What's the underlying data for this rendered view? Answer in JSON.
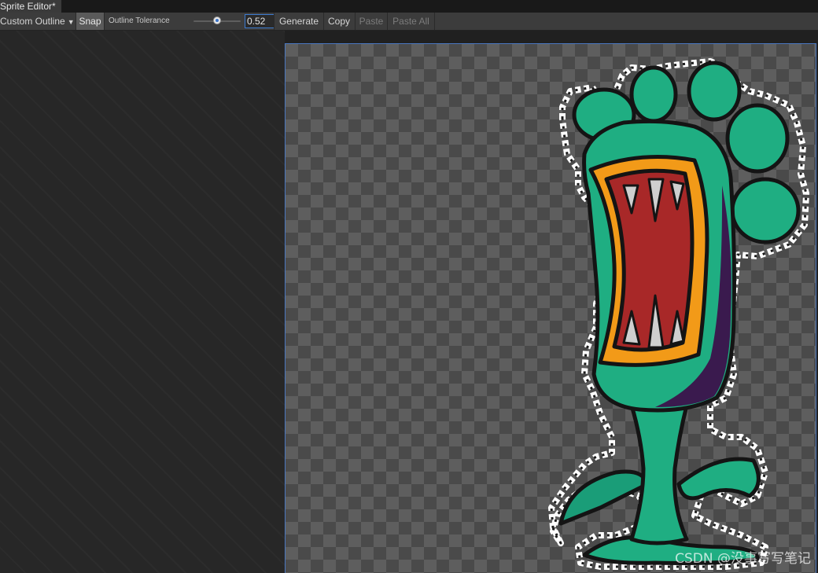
{
  "window": {
    "tab_title": "Sprite Editor*"
  },
  "toolbar": {
    "mode_dropdown": "Custom Outline",
    "snap_label": "Snap",
    "tolerance_label": "Outline Tolerance",
    "tolerance_value": "0.52",
    "generate_label": "Generate",
    "copy_label": "Copy",
    "paste_label": "Paste",
    "paste_all_label": "Paste All"
  },
  "icons": {
    "dropdown": "chevron-down-icon",
    "slider": "slider-thumb-icon"
  },
  "colors": {
    "accent": "#3d7bd0",
    "plant_green": "#1fae82",
    "plant_purple": "#3a1a4e",
    "mouth_red": "#a82828",
    "lip_orange": "#f29a18",
    "outline_handle": "#ffffff"
  },
  "watermark": "CSDN @没事写写笔记"
}
